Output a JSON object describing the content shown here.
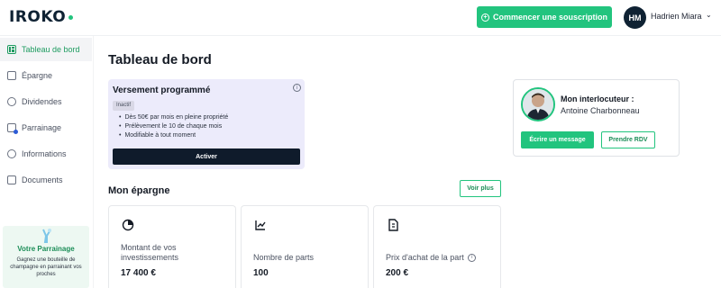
{
  "header": {
    "logo": "IROKO",
    "cta_label": "Commencer une souscription",
    "user_initials": "HM",
    "user_name": "Hadrien Miara"
  },
  "sidebar": {
    "items": [
      {
        "label": "Tableau de bord",
        "icon": "dashboard-icon",
        "active": true
      },
      {
        "label": "Épargne",
        "icon": "wallet-icon",
        "active": false
      },
      {
        "label": "Dividendes",
        "icon": "pie-chart-icon",
        "active": false
      },
      {
        "label": "Parrainage",
        "icon": "referral-icon",
        "active": false
      },
      {
        "label": "Informations",
        "icon": "user-circle-icon",
        "active": false
      },
      {
        "label": "Documents",
        "icon": "folder-icon",
        "active": false
      }
    ],
    "promo": {
      "title": "Votre Parrainage",
      "text": "Gagnez une bouteille de champagne en parrainant vos proches"
    }
  },
  "main": {
    "title": "Tableau de bord",
    "scheduled": {
      "title": "Versement programmé",
      "status": "Inactif",
      "bullets": [
        "Dès 50€ par mois en pleine propriété",
        "Prélèvement le 10 de chaque mois",
        "Modifiable à tout moment"
      ],
      "button": "Activer"
    },
    "contact": {
      "label": "Mon interlocuteur :",
      "name": "Antoine Charbonneau",
      "message_button": "Écrire un message",
      "appointment_button": "Prendre RDV"
    },
    "savings": {
      "title": "Mon épargne",
      "see_more": "Voir plus",
      "stats": [
        {
          "label": "Montant de vos investissements",
          "value": "17 400 €",
          "icon": "pie-chart-icon"
        },
        {
          "label": "Nombre de parts",
          "value": "100",
          "icon": "line-chart-icon"
        },
        {
          "label": "Prix d'achat de la part",
          "value": "200 €",
          "icon": "document-icon"
        }
      ]
    }
  },
  "colors": {
    "accent": "#22c47e",
    "dark": "#0f1b2b",
    "card_lavender": "#ecebfb",
    "promo_bg": "#edf8f2"
  }
}
